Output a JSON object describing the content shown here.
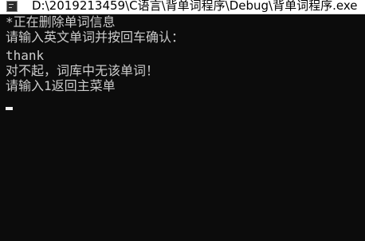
{
  "window": {
    "title": "D:\\2019213459\\C语言\\背单词程序\\Debug\\背单词程序.exe"
  },
  "console": {
    "lines": [
      "*正在删除单词信息",
      "请输入英文单词并按回车确认：",
      "thank",
      "对不起，词库中无该单词！",
      "请输入1返回主菜单"
    ]
  },
  "colors": {
    "console_background": "#0c0c0c",
    "console_text": "#cccccc",
    "titlebar_background": "#ffffff",
    "title_text": "#000000",
    "cursor": "#f2f2f2"
  },
  "icons": {
    "app_icon": "console-app-icon"
  }
}
